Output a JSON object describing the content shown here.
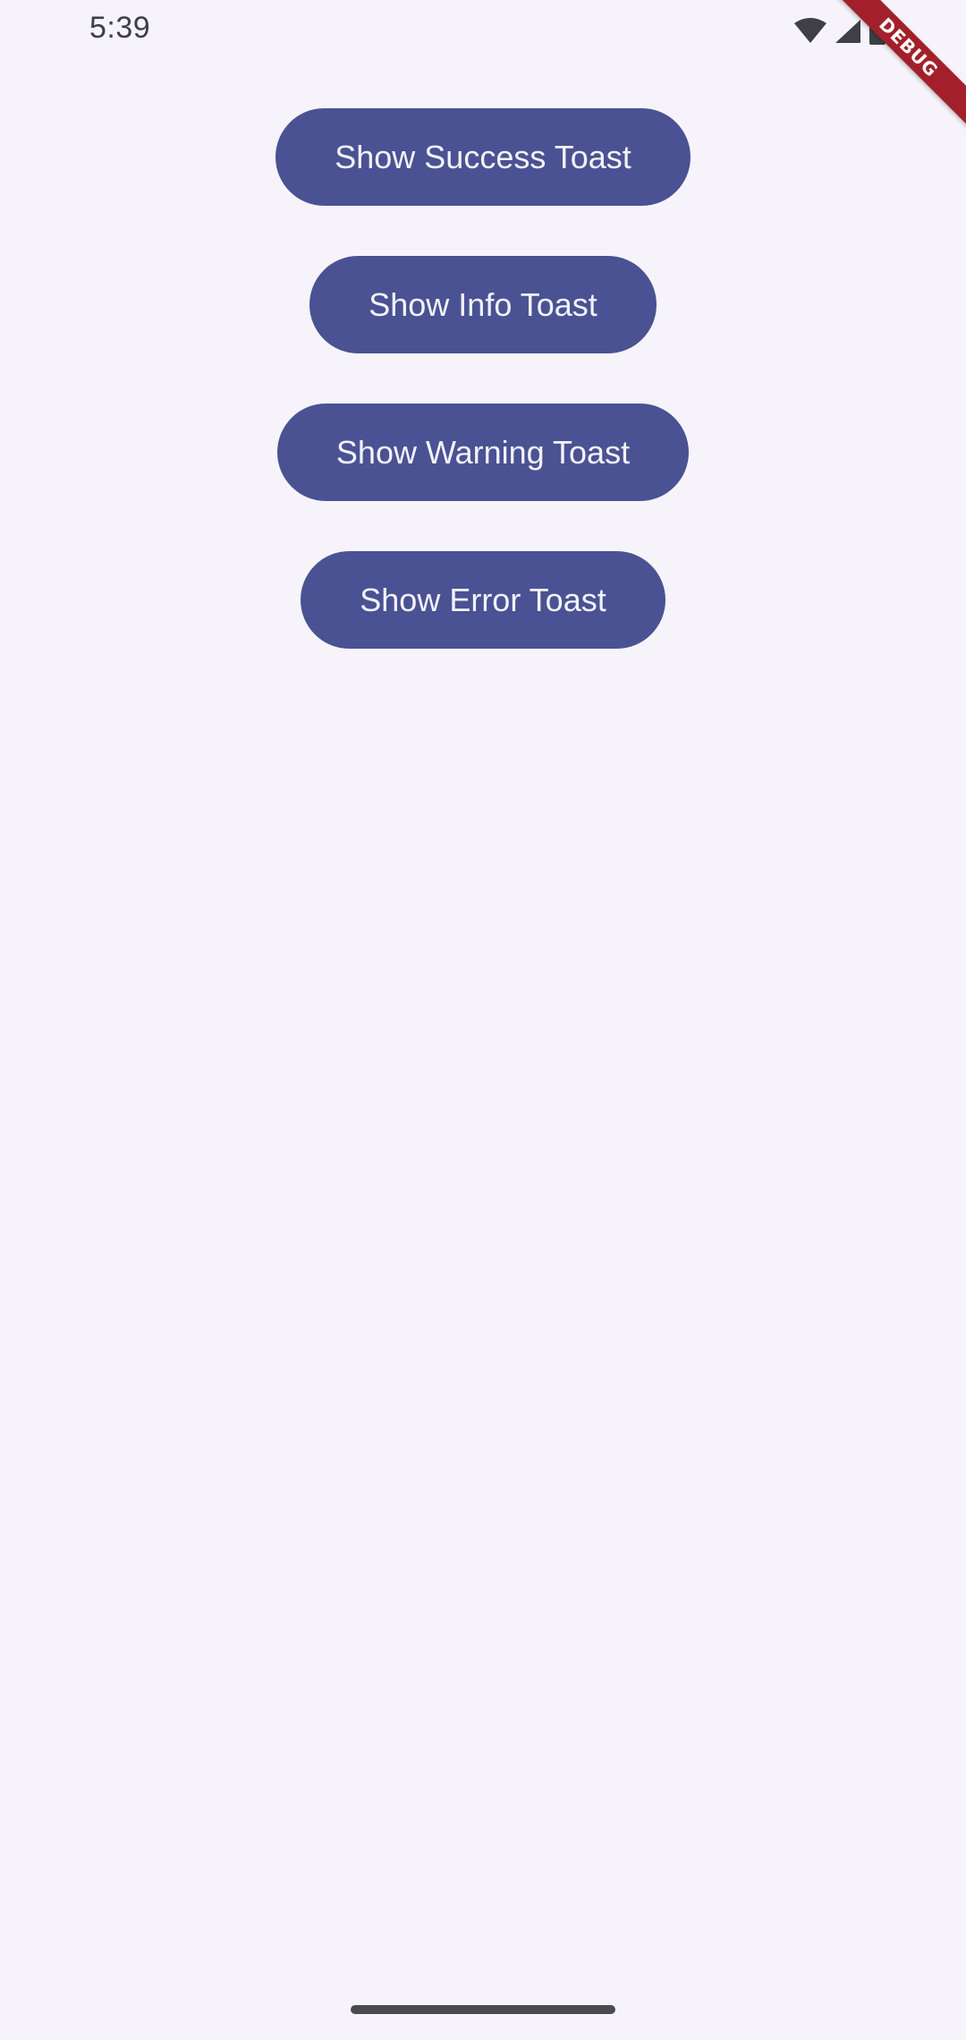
{
  "status_bar": {
    "time": "5:39",
    "icons": [
      "wifi-icon",
      "cellular-signal-icon",
      "battery-icon"
    ]
  },
  "debug_banner": {
    "label": "DEBUG"
  },
  "buttons": [
    {
      "label": "Show Success Toast"
    },
    {
      "label": "Show Info Toast"
    },
    {
      "label": "Show Warning Toast"
    },
    {
      "label": "Show Error Toast"
    }
  ],
  "colors": {
    "background": "#f6f4fa",
    "button_fill": "#4a5293",
    "button_text": "#f2f2f8",
    "debug_ribbon": "#a3202a"
  }
}
